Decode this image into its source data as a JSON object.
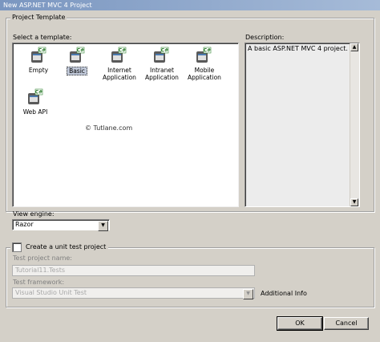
{
  "window": {
    "title": "New ASP.NET MVC 4 Project"
  },
  "project_template": {
    "group_label": "Project Template",
    "select_label": "Select a template:",
    "templates": [
      {
        "label": "Empty",
        "selected": false
      },
      {
        "label": "Basic",
        "selected": true
      },
      {
        "label": "Internet\nApplication",
        "selected": false
      },
      {
        "label": "Intranet\nApplication",
        "selected": false
      },
      {
        "label": "Mobile\nApplication",
        "selected": false
      },
      {
        "label": "Web API",
        "selected": false
      }
    ],
    "watermark": "© Tutlane.com",
    "description_label": "Description:",
    "description_text": "A basic ASP.NET MVC 4 project."
  },
  "view_engine": {
    "label": "View engine:",
    "value": "Razor"
  },
  "unit_test": {
    "checkbox_label": "Create a unit test project",
    "checked": false,
    "project_name_label": "Test project name:",
    "project_name_value": "Tutorial11.Tests",
    "framework_label": "Test framework:",
    "framework_value": "Visual Studio Unit Test",
    "additional_info": "Additional Info"
  },
  "buttons": {
    "ok": "OK",
    "cancel": "Cancel"
  },
  "icons": {
    "template_icon": "project-template-icon",
    "csharp_badge": "C#",
    "dropdown": "▼",
    "scroll_up": "▲",
    "scroll_down": "▼"
  },
  "colors": {
    "title_bar": "#7a96c0",
    "dialog_bg": "#d4d0c8",
    "selection": "#c0c8d8"
  }
}
